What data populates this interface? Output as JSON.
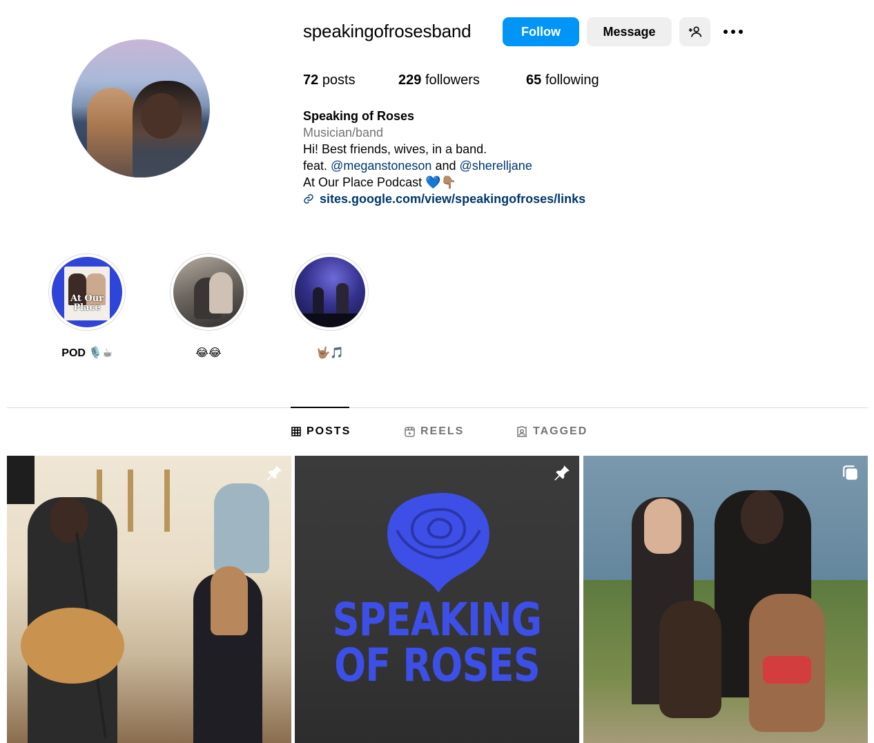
{
  "profile": {
    "username": "speakingofrosesband",
    "follow_label": "Follow",
    "message_label": "Message",
    "stats": {
      "posts_count": "72",
      "posts_label": "posts",
      "followers_count": "229",
      "followers_label": "followers",
      "following_count": "65",
      "following_label": "following"
    },
    "bio": {
      "display_name": "Speaking of Roses",
      "category": "Musician/band",
      "line1": "Hi! Best friends, wives, in a band.",
      "line2_prefix": "feat.",
      "mention1": "@meganstoneson",
      "line2_and": "and",
      "mention2": "@sherelljane",
      "line3": "At Our Place Podcast 💙👇🏽",
      "link": "sites.google.com/view/speakingofroses/links"
    }
  },
  "highlights": [
    {
      "label": "POD 🎙️☕",
      "cover_text": "At Our Place"
    },
    {
      "label": "😂😂"
    },
    {
      "label": "🤟🏽🎵"
    }
  ],
  "tabs": {
    "posts": "POSTS",
    "reels": "REELS",
    "tagged": "TAGGED"
  },
  "posts": [
    {
      "pinned": true
    },
    {
      "pinned": true,
      "title_line1": "SPEAKING",
      "title_line2": "OF ROSES"
    },
    {
      "pinned": false,
      "multi": true
    }
  ],
  "colors": {
    "accent": "#0095f6",
    "link": "#00376b",
    "muted": "#737373",
    "rose_blue": "#3d4fe6"
  }
}
